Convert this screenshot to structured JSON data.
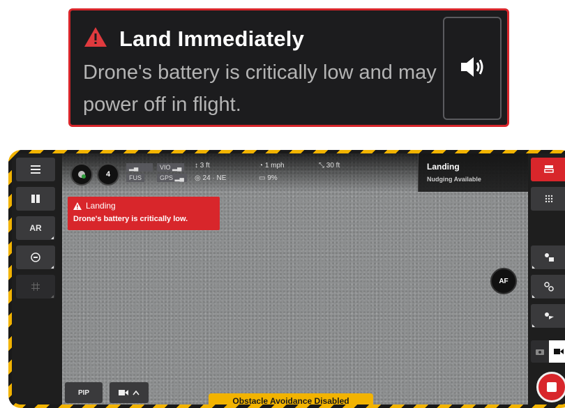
{
  "alert": {
    "title": "Land Immediately",
    "body": "Drone's battery is critically low and may power off in flight.",
    "icon": "warning-triangle-icon",
    "sound_icon": "speaker-icon",
    "accent": "#d8262b"
  },
  "screen": {
    "left_rail": {
      "menu_icon": "menu-icon",
      "pause_icon": "pause-icon",
      "ar_label": "AR",
      "gimbal_icon": "gimbal-icon",
      "grid_icon": "grid-icon"
    },
    "telemetry": {
      "satellites": "4",
      "vio_label": "VIO",
      "fus_label": "FUS",
      "gps_label": "GPS",
      "altitude": "3 ft",
      "speed": "1 mph",
      "distance": "30 ft",
      "heading": "24 · NE",
      "battery": "9%"
    },
    "landing_warning": {
      "title": "Landing",
      "body": "Drone's battery is critically low."
    },
    "status_panel": {
      "title": "Landing",
      "subtitle": "Nudging Available"
    },
    "af_label": "AF",
    "pip_label": "PIP",
    "obstacle_banner": "Obstacle Avoidance Disabled",
    "colors": {
      "hazard_yellow": "#f2b300",
      "alert_red": "#d8262b"
    }
  }
}
